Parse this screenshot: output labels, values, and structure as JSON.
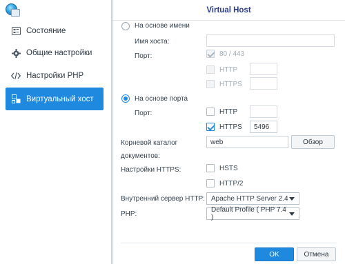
{
  "sidebar": {
    "items": [
      {
        "label": "Состояние",
        "icon": "status-icon"
      },
      {
        "label": "Общие настройки",
        "icon": "gear-icon"
      },
      {
        "label": "Настройки PHP",
        "icon": "code-icon"
      },
      {
        "label": "Виртуальный хост",
        "icon": "virtual-host-icon",
        "active": true
      }
    ]
  },
  "dialog": {
    "title": "Virtual Host",
    "name_based_label": "На основе имени",
    "hostname_label": "Имя хоста:",
    "hostname_value": "",
    "port_label_1": "Порт:",
    "port_80_443": "80 / 443",
    "http_label_1": "HTTP",
    "https_label_1": "HTTPS",
    "port_based_label": "На основе порта",
    "port_label_2": "Порт:",
    "http_label_2": "HTTP",
    "https_label_2": "HTTPS",
    "https_port_value": "5496",
    "root_dir_label_1": "Корневой каталог",
    "root_dir_label_2": "документов:",
    "root_dir_value": "web",
    "browse_button": "Обзор",
    "https_settings_label": "Настройки HTTPS:",
    "hsts_label": "HSTS",
    "http2_label": "HTTP/2",
    "backend_label": "Внутренний сервер HTTP:",
    "backend_value": "Apache HTTP Server 2.4",
    "php_label": "PHP:",
    "php_value": "Default Profile ( PHP 7.4 )",
    "ok_button": "OK",
    "cancel_button": "Отмена"
  },
  "colors": {
    "accent": "#1f89e0",
    "title": "#2a3b8f"
  }
}
